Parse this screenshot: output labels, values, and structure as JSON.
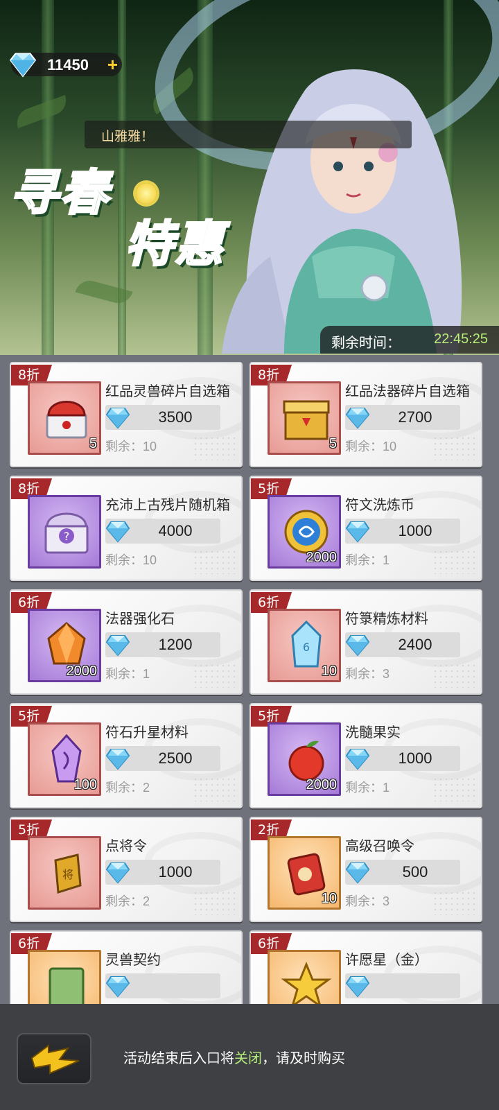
{
  "header": {
    "currency": {
      "icon": "diamond-icon",
      "amount": "11450",
      "add": "+"
    },
    "speech": "山雅雅！",
    "title_line1": "寻春",
    "title_line2": "特惠",
    "timer_label": "剩余时间：",
    "timer_value": "22:45:25"
  },
  "items": [
    {
      "discount": "8折",
      "name": "红品灵兽碎片自选箱",
      "price": "3500",
      "remain_label": "剩余：",
      "remain": "10",
      "qty": "5",
      "frame": "red",
      "icon": "red-chest-icon"
    },
    {
      "discount": "8折",
      "name": "红品法器碎片自选箱",
      "price": "2700",
      "remain_label": "剩余：",
      "remain": "10",
      "qty": "5",
      "frame": "red",
      "icon": "gold-chest-icon"
    },
    {
      "discount": "8折",
      "name": "充沛上古残片随机箱",
      "price": "4000",
      "remain_label": "剩余：",
      "remain": "10",
      "qty": "",
      "frame": "purple",
      "icon": "mystery-chest-icon"
    },
    {
      "discount": "5折",
      "name": "符文洗炼币",
      "price": "1000",
      "remain_label": "剩余：",
      "remain": "1",
      "qty": "2000",
      "frame": "purple",
      "icon": "rune-coin-icon"
    },
    {
      "discount": "6折",
      "name": "法器强化石",
      "price": "1200",
      "remain_label": "剩余：",
      "remain": "1",
      "qty": "2000",
      "frame": "purple",
      "icon": "orange-crystal-icon"
    },
    {
      "discount": "6折",
      "name": "符箓精炼材料",
      "price": "2400",
      "remain_label": "剩余：",
      "remain": "3",
      "qty": "10",
      "frame": "red",
      "icon": "blue-crystal-icon"
    },
    {
      "discount": "5折",
      "name": "符石升星材料",
      "price": "2500",
      "remain_label": "剩余：",
      "remain": "2",
      "qty": "100",
      "frame": "red",
      "icon": "purple-crystal-icon"
    },
    {
      "discount": "5折",
      "name": "洗髓果实",
      "price": "1000",
      "remain_label": "剩余：",
      "remain": "1",
      "qty": "2000",
      "frame": "purple",
      "icon": "red-fruit-icon"
    },
    {
      "discount": "5折",
      "name": "点将令",
      "price": "1000",
      "remain_label": "剩余：",
      "remain": "2",
      "qty": "",
      "frame": "red",
      "icon": "gold-token-icon"
    },
    {
      "discount": "2折",
      "name": "高级召唤令",
      "price": "500",
      "remain_label": "剩余：",
      "remain": "3",
      "qty": "10",
      "frame": "orange",
      "icon": "summon-scroll-icon"
    },
    {
      "discount": "6折",
      "name": "灵兽契约",
      "price": "",
      "remain_label": "",
      "remain": "",
      "qty": "",
      "frame": "orange",
      "icon": "contract-scroll-icon"
    },
    {
      "discount": "6折",
      "name": "许愿星（金）",
      "price": "",
      "remain_label": "",
      "remain": "",
      "qty": "",
      "frame": "orange",
      "icon": "gold-star-icon"
    }
  ],
  "footer": {
    "back_icon": "back-arrow-icon",
    "notice_pre": "活动结束后入口将",
    "notice_highlight": "关闭",
    "notice_post": "，请及时购买"
  },
  "colors": {
    "discount_tag": "#a7282a",
    "timer_value": "#b8ee7a",
    "highlight": "#b4ec7b",
    "currency_plus": "#ffcf2e"
  }
}
